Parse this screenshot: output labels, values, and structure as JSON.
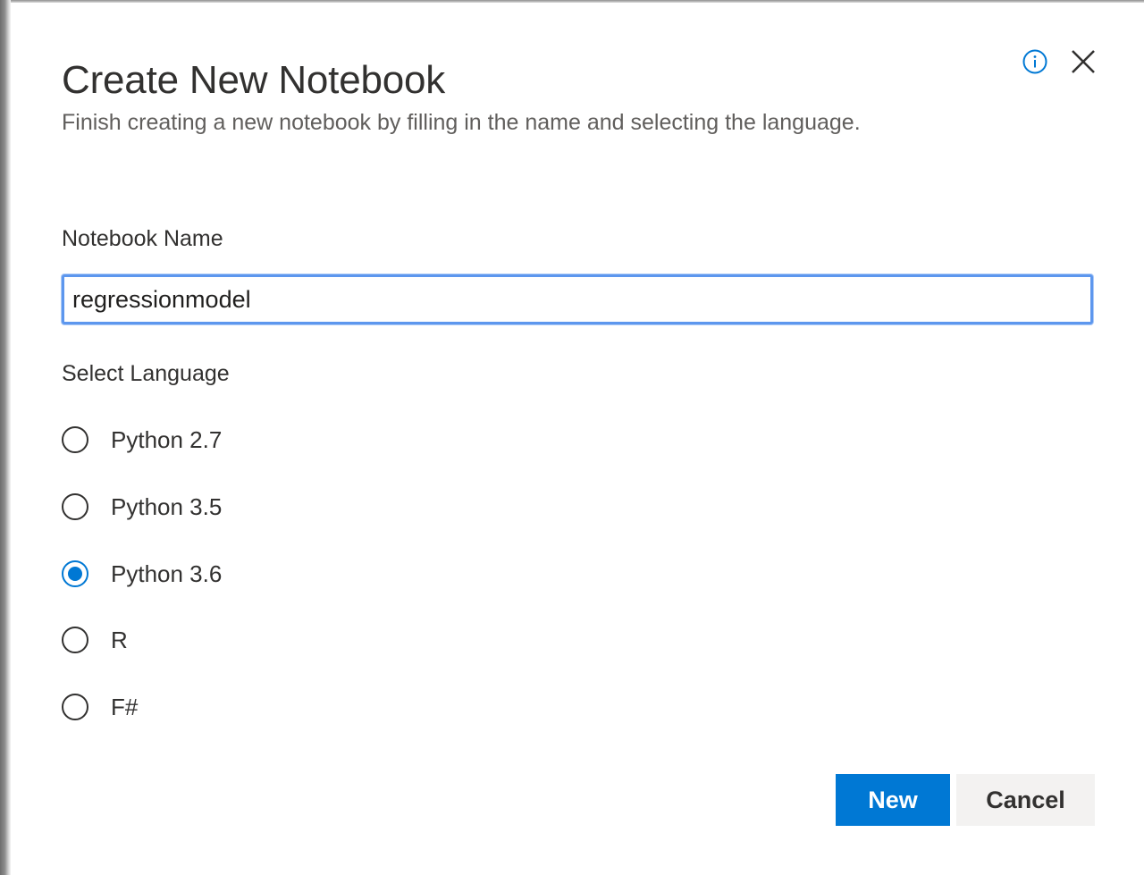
{
  "dialog": {
    "title": "Create New Notebook",
    "subtitle": "Finish creating a new notebook by filling in the name and selecting the language.",
    "info_icon": "info-icon",
    "close_icon": "close-icon"
  },
  "name_field": {
    "label": "Notebook Name",
    "value": "regressionmodel"
  },
  "language": {
    "label": "Select Language",
    "options": [
      {
        "label": "Python 2.7",
        "selected": false
      },
      {
        "label": "Python 3.5",
        "selected": false
      },
      {
        "label": "Python 3.6",
        "selected": true
      },
      {
        "label": "R",
        "selected": false
      },
      {
        "label": "F#",
        "selected": false
      }
    ]
  },
  "buttons": {
    "new_label": "New",
    "cancel_label": "Cancel"
  },
  "colors": {
    "accent": "#0078d4",
    "input_focus_border": "#5d97ee",
    "text_primary": "#323130",
    "text_secondary": "#605e5c",
    "cancel_background": "#f3f2f1"
  }
}
